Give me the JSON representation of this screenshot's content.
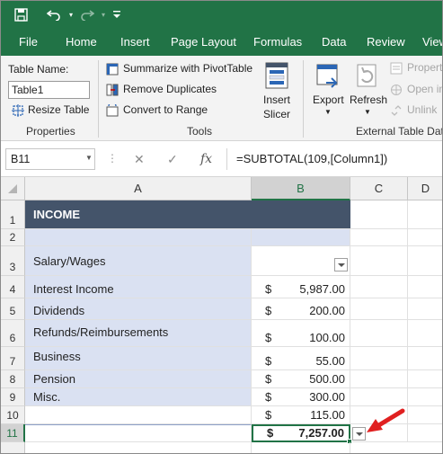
{
  "qat": {
    "icons": [
      "save-icon",
      "undo-icon",
      "redo-icon",
      "customize-icon"
    ]
  },
  "tabs": [
    "File",
    "Home",
    "Insert",
    "Page Layout",
    "Formulas",
    "Data",
    "Review",
    "View"
  ],
  "ribbon": {
    "properties": {
      "table_name_label": "Table Name:",
      "table_name_value": "Table1",
      "resize_label": "Resize Table",
      "group_label": "Properties"
    },
    "tools": {
      "summarize": "Summarize with PivotTable",
      "remove_duplicates": "Remove Duplicates",
      "convert": "Convert to Range",
      "insert_slicer_1": "Insert",
      "insert_slicer_2": "Slicer",
      "group_label": "Tools"
    },
    "external": {
      "export": "Export",
      "refresh": "Refresh",
      "properties": "Propert",
      "open_in": "Open in",
      "unlink": "Unlink",
      "group_label": "External Table Data"
    }
  },
  "formula_bar": {
    "name_box": "B11",
    "cancel": "✕",
    "enter": "✓",
    "fx": "fx",
    "formula": "=SUBTOTAL(109,[Column1])"
  },
  "columns": [
    "A",
    "B",
    "C",
    "D"
  ],
  "rows": [
    "1",
    "2",
    "3",
    "4",
    "5",
    "6",
    "7",
    "8",
    "9",
    "10",
    "11"
  ],
  "table": {
    "header": "INCOME",
    "labels": [
      "Salary/Wages",
      "Interest Income",
      "Dividends",
      "Refunds/Reimbursements",
      "Business",
      "Pension",
      "Misc."
    ],
    "currency": "$",
    "values": [
      "",
      "5,987.00",
      "200.00",
      "100.00",
      "55.00",
      "500.00",
      "300.00",
      "115.00"
    ],
    "total_currency": "$",
    "total": "7,257.00"
  },
  "colors": {
    "excel_green": "#217346",
    "header_fill": "#44546a",
    "band_fill": "#dae1f2",
    "arrow_red": "#e02020"
  }
}
